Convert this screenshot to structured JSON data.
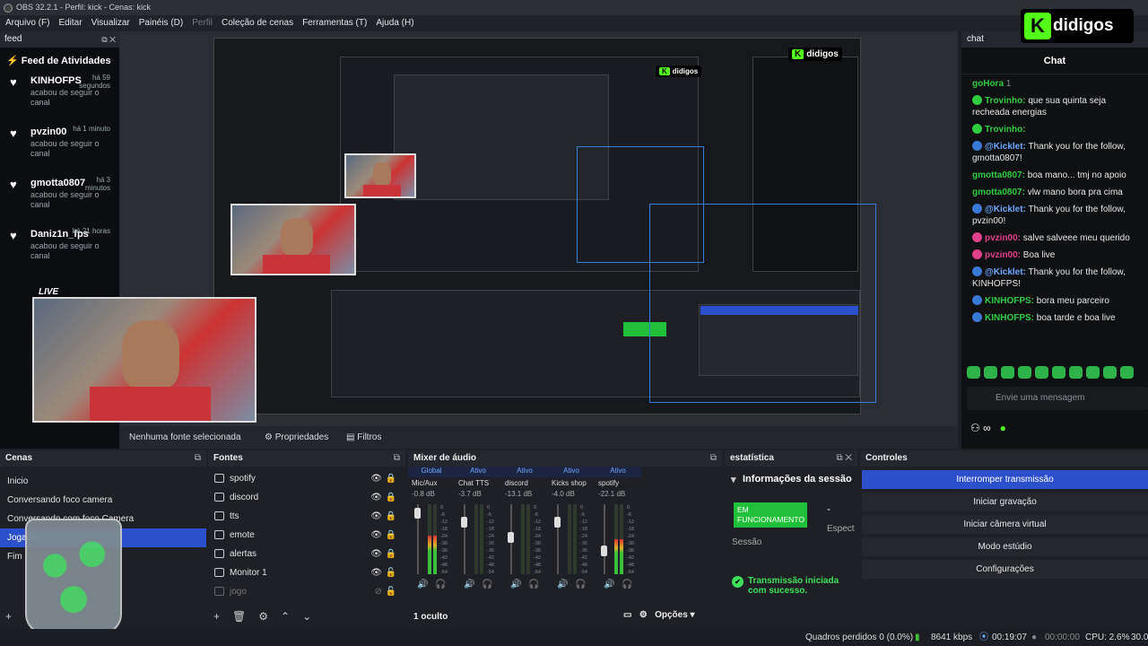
{
  "window": {
    "title": "OBS 32.2.1 - Perfil: kick - Cenas: kick"
  },
  "menu": [
    "Arquivo (F)",
    "Editar",
    "Visualizar",
    "Painéis (D)",
    "Perfil",
    "Coleção de cenas",
    "Ferramentas (T)",
    "Ajuda (H)"
  ],
  "feed": {
    "dock_title": "feed",
    "title": "Feed de Atividades",
    "items": [
      {
        "user": "KINHOFPS",
        "time": "há 59 segundos",
        "action": "acabou de seguir o canal"
      },
      {
        "user": "pvzin00",
        "time": "há 1 minuto",
        "action": "acabou de seguir o canal"
      },
      {
        "user": "gmotta0807",
        "time": "há 3 minutos",
        "action": "acabou de seguir o canal"
      },
      {
        "user": "Daniz1n_fps",
        "time": "há 21 horas",
        "action": "acabou de seguir o canal"
      }
    ]
  },
  "preview": {
    "cam_label": "LIVE",
    "no_source": "Nenhuma fonte selecionada",
    "properties": "Propriedades",
    "filters": "Filtros"
  },
  "brand": {
    "name": "didigos",
    "k": "K"
  },
  "chat": {
    "dock_title": "chat",
    "title": "Chat",
    "header_user": "goHora",
    "header_num": "1",
    "messages": [
      {
        "user": "Trovinho:",
        "text": "que sua quinta seja recheada energias",
        "color": "#2ecc40",
        "badge": "#2ecc40"
      },
      {
        "user": "Trovinho:",
        "text": "",
        "color": "#2ecc40",
        "badge": "#2ecc40"
      },
      {
        "user": "@Kicklet:",
        "text": "Thank you for the follow, gmotta0807!",
        "color": "#6aa7ff",
        "badge": "#3a78d6"
      },
      {
        "user": "gmotta0807:",
        "text": "boa mano... tmj no apoio",
        "color": "#2ecc40",
        "badge": ""
      },
      {
        "user": "gmotta0807:",
        "text": "vlw mano bora pra cima",
        "color": "#2ecc40",
        "badge": ""
      },
      {
        "user": "@Kicklet:",
        "text": "Thank you for the follow, pvzin00!",
        "color": "#6aa7ff",
        "badge": "#3a78d6"
      },
      {
        "user": "pvzin00:",
        "text": "salve salveee meu querido",
        "color": "#e0408a",
        "badge": "#e0408a"
      },
      {
        "user": "pvzin00:",
        "text": "Boa live",
        "color": "#e0408a",
        "badge": "#e0408a"
      },
      {
        "user": "@Kicklet:",
        "text": "Thank you for the follow, KINHOFPS!",
        "color": "#6aa7ff",
        "badge": "#3a78d6"
      },
      {
        "user": "KINHOFPS:",
        "text": "bora meu parceiro",
        "color": "#2ecc40",
        "badge": "#3a78d6"
      },
      {
        "user": "KINHOFPS:",
        "text": "boa tarde e boa live",
        "color": "#2ecc40",
        "badge": "#3a78d6"
      }
    ],
    "send_placeholder": "Envie uma mensagem"
  },
  "scenes": {
    "title": "Cenas",
    "items": [
      "Inicio",
      "Conversando foco camera",
      "Conversando com foco Camera",
      "Jogando",
      "Fim"
    ],
    "selected": 3
  },
  "sources": {
    "title": "Fontes",
    "items": [
      {
        "name": "spotify",
        "dim": false
      },
      {
        "name": "discord",
        "dim": false
      },
      {
        "name": "tts",
        "dim": false
      },
      {
        "name": "emote",
        "dim": false
      },
      {
        "name": "alertas",
        "dim": false
      },
      {
        "name": "Monitor 1",
        "dim": false
      },
      {
        "name": "jogo",
        "dim": true
      }
    ]
  },
  "mixer": {
    "title": "Mixer de áudio",
    "tabs": [
      "Global",
      "Ativo",
      "Ativo",
      "Ativo",
      "Ativo"
    ],
    "channels": [
      {
        "name": "Mic/Aux",
        "db": "-0.8 dB",
        "level": 0.55,
        "fader": 0.88
      },
      {
        "name": "Chat TTS",
        "db": "-3.7 dB",
        "level": 0.0,
        "fader": 0.75
      },
      {
        "name": "discord",
        "db": "-13.1 dB",
        "level": 0.0,
        "fader": 0.5
      },
      {
        "name": "Kicks shop",
        "db": "-4.0 dB",
        "level": 0.0,
        "fader": 0.75
      },
      {
        "name": "spotify",
        "db": "-22.1 dB",
        "level": 0.5,
        "fader": 0.28
      }
    ],
    "scale": [
      "0",
      "-6",
      "-12",
      "-18",
      "-24",
      "-30",
      "-36",
      "-42",
      "-48",
      "-54"
    ],
    "hidden": "1 oculto",
    "options": "Opções"
  },
  "stats": {
    "title": "estatística",
    "session_title": "Informações da sessão",
    "status": "EM FUNCIONAMENTO",
    "dash": "-",
    "session_label": "Sessão",
    "esp": "Espect",
    "ok": "Transmissão iniciada com sucesso."
  },
  "controls": {
    "title": "Controles",
    "buttons": [
      "Interromper transmissão",
      "Iniciar gravação",
      "Iniciar câmera virtual",
      "Modo estúdio",
      "Configurações"
    ]
  },
  "status": {
    "frames": "Quadros perdidos 0 (0.0%)",
    "kbps": "8641 kbps",
    "live_time": "00:19:07",
    "rec_time": "00:00:00",
    "cpu": "CPU: 2.6%",
    "fps": "30.0"
  }
}
